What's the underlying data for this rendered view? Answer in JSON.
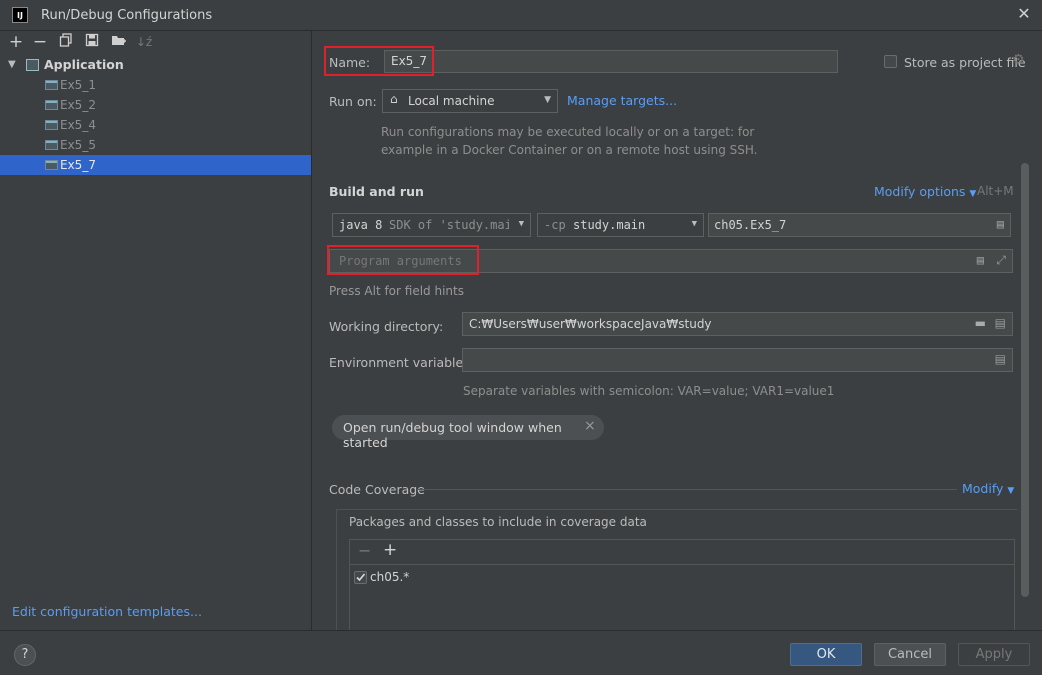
{
  "window": {
    "title": "Run/Debug Configurations",
    "app_icon_text": "IJ"
  },
  "toolbar": {
    "icons": [
      "add-icon",
      "remove-icon",
      "copy-icon",
      "save-icon",
      "new-folder-icon",
      "sort-icon"
    ]
  },
  "tree": {
    "root_label": "Application",
    "items": [
      "Ex5_1",
      "Ex5_2",
      "Ex5_4",
      "Ex5_5",
      "Ex5_7"
    ],
    "selected": "Ex5_7"
  },
  "edit_templates_link": "Edit configuration templates...",
  "name": {
    "label": "Name:",
    "value": "Ex5_7"
  },
  "store_as_project_file": {
    "label": "Store as project file",
    "checked": false
  },
  "run_on": {
    "label": "Run on:",
    "value": "Local machine",
    "manage_link": "Manage targets..."
  },
  "run_on_hint": [
    "Run configurations may be executed locally or on a target: for",
    "example in a Docker Container or on a remote host using SSH."
  ],
  "build_and_run": {
    "title": "Build and run",
    "modify_options": "Modify options",
    "shortcut": "Alt+M",
    "jdk_prefix": "java 8",
    "jdk_detail": "SDK of 'study.mai",
    "cp_prefix": "-cp",
    "cp_value": "study.main",
    "main_class": "ch05.Ex5_7",
    "program_args_placeholder": "Program arguments",
    "field_hint": "Press Alt for field hints"
  },
  "working_directory": {
    "label": "Working directory:",
    "value": "C:₩Users₩user₩workspaceJava₩study"
  },
  "environment_variables": {
    "label": "Environment variables:",
    "value": "",
    "hint": "Separate variables with semicolon: VAR=value; VAR1=value1"
  },
  "chip": {
    "label": "Open run/debug tool window when started",
    "close": "×"
  },
  "code_coverage": {
    "title": "Code Coverage",
    "modify": "Modify",
    "packages_label": "Packages and classes to include in coverage data",
    "entries": [
      {
        "label": "ch05.*",
        "checked": true
      }
    ]
  },
  "buttons": {
    "help": "?",
    "ok": "OK",
    "cancel": "Cancel",
    "apply": "Apply"
  },
  "colors": {
    "accent": "#589df6",
    "selection": "#2f65ca",
    "highlight": "#e0202a",
    "background": "#3c3f41"
  }
}
